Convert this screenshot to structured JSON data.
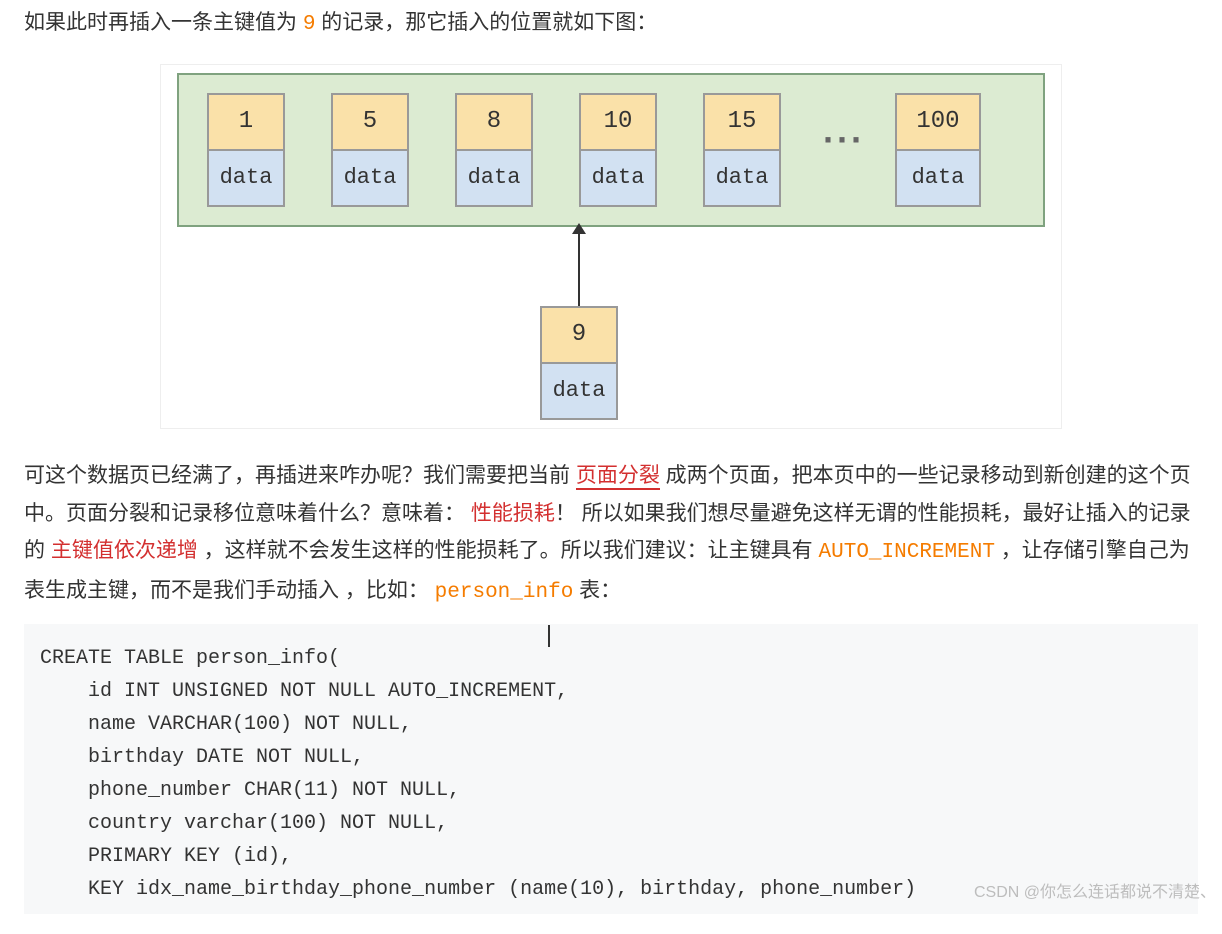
{
  "para1": {
    "seg1": "如果此时再插入一条主键值为 ",
    "key": "9",
    "seg2": " 的记录，那它插入的位置就如下图：",
    "full": "如果此时再插入一条主键值为 9 的记录，那它插入的位置就如下图："
  },
  "diagram": {
    "data_label": "data",
    "ellipsis": "···",
    "keys": [
      "1",
      "5",
      "8",
      "10",
      "15",
      "100"
    ],
    "insert_key": "9"
  },
  "para2": {
    "seg1": "可这个数据页已经满了，再插进来咋办呢？我们需要把当前 ",
    "page_split": "页面分裂",
    "seg2": " 成两个页面，把本页中的一些记录移动到新创建的这个页中。页面分裂和记录移位意味着什么？意味着： ",
    "perf": "性能损耗",
    "seg3": "！ 所以如果我们想尽量避免这样无谓的性能损耗，最好让插入的记录的 ",
    "pk_inc": "主键值依次递增",
    "seg4": " ，这样就不会发生这样的性能损耗了。所以我们建议：让主键具有 ",
    "auto": "AUTO_INCREMENT",
    "seg5": " ，让存储引擎自己为表生成主键，而不是我们手动插入 ，比如： ",
    "tbl": "person_info",
    "seg6": " 表："
  },
  "code": "CREATE TABLE person_info(\n    id INT UNSIGNED NOT NULL AUTO_INCREMENT,\n    name VARCHAR(100) NOT NULL,\n    birthday DATE NOT NULL,\n    phone_number CHAR(11) NOT NULL,\n    country varchar(100) NOT NULL,\n    PRIMARY KEY (id),\n    KEY idx_name_birthday_phone_number (name(10), birthday, phone_number)",
  "watermark": "CSDN @你怎么连话都说不清楚、"
}
